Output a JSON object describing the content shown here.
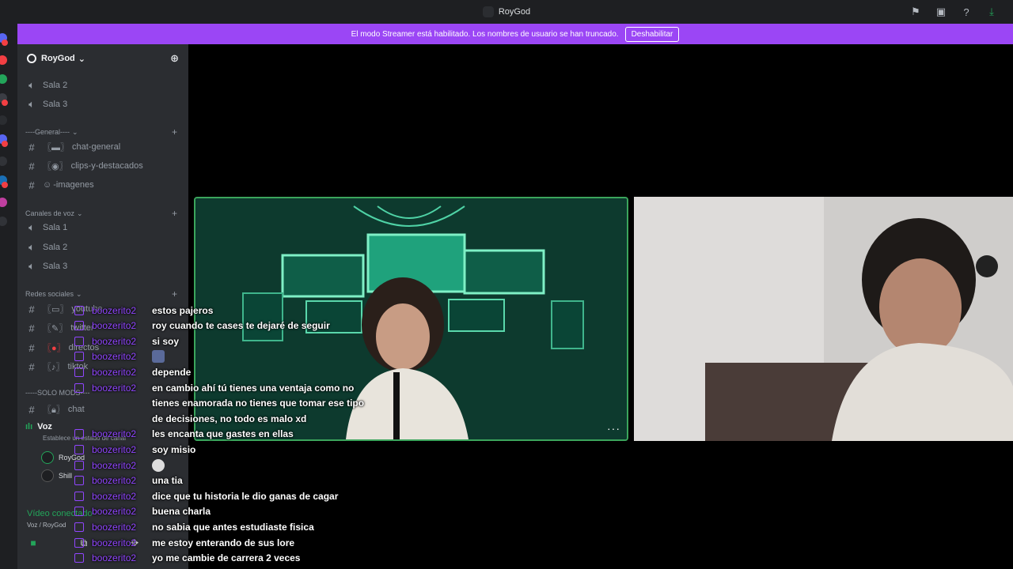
{
  "window": {
    "title": "RoyGod"
  },
  "banner": {
    "text": "El modo Streamer está habilitado. Los nombres de usuario se han truncado.",
    "button": "Deshabilitar"
  },
  "server": {
    "name": "RoyGod"
  },
  "channels": {
    "top": [
      "Sala 2",
      "Sala 3"
    ],
    "general_category": "----General----",
    "general": [
      "chat-general",
      "clips-y-destacados",
      "-imagenes"
    ],
    "voice_category": "Canales de voz",
    "voice": [
      "Sala 1",
      "Sala 2",
      "Sala 3"
    ],
    "social_category": "Redes sociales",
    "social": [
      "youtube",
      "twitter",
      "directos",
      "tiktok"
    ],
    "mods_category": "-----SOLO MODS----",
    "mods": [
      "chat"
    ]
  },
  "voice_panel": {
    "channel": "Voz",
    "status": "Establece un estado de canal",
    "users": [
      "RoyGod",
      "Shill"
    ],
    "connection": "Vídeo conectado",
    "location": "Voz / RoyGod"
  },
  "chat_messages": [
    {
      "user": "boozerito2",
      "text": "estos pajeros"
    },
    {
      "user": "boozerito2",
      "text": "roy cuando te cases te dejaré de seguir"
    },
    {
      "user": "boozerito2",
      "text": "si soy"
    },
    {
      "user": "boozerito2",
      "text": ""
    },
    {
      "user": "boozerito2",
      "text": "depende"
    },
    {
      "user": "boozerito2",
      "text": "en cambio ahí tú tienes una ventaja como no"
    },
    {
      "user": "",
      "text": "tienes enamorada no tienes que tomar ese tipo"
    },
    {
      "user": "",
      "text": "de decisiones, no todo es malo xd"
    },
    {
      "user": "boozerito2",
      "text": "les encanta que gastes en ellas"
    },
    {
      "user": "boozerito2",
      "text": "soy misio"
    },
    {
      "user": "boozerito2",
      "text": ""
    },
    {
      "user": "boozerito2",
      "text": "una tia"
    },
    {
      "user": "boozerito2",
      "text": "dice que tu historia le dio ganas de cagar"
    },
    {
      "user": "boozerito2",
      "text": "buena charla"
    },
    {
      "user": "boozerito2",
      "text": "no sabia que antes estudiaste fisica"
    },
    {
      "user": "boozerito2",
      "text": "me estoy enterando de sus lore"
    },
    {
      "user": "boozerito2",
      "text": "yo me cambie de carrera 2 veces"
    }
  ],
  "colors": {
    "accent": "#9b46f5",
    "twitch": "#9146ff",
    "speaking": "#3ba55c"
  }
}
